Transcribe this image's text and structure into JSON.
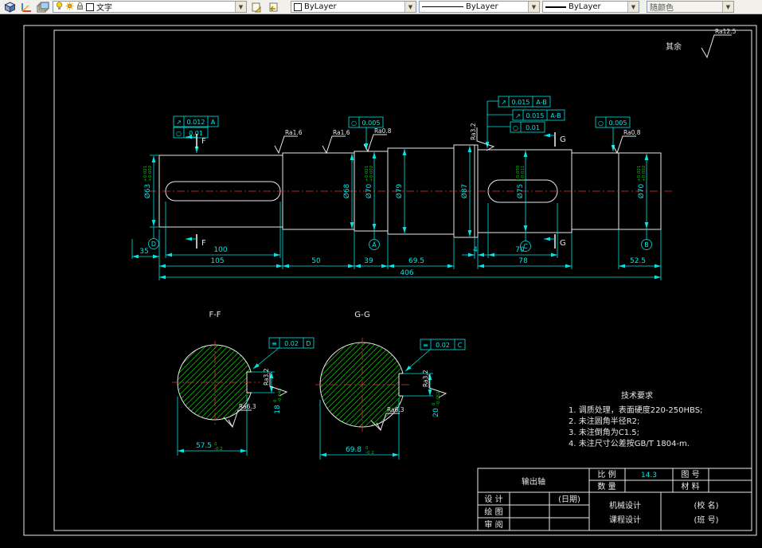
{
  "toolbar": {
    "layer": {
      "value": "文字"
    },
    "color": {
      "value": "ByLayer"
    },
    "linetype": {
      "value": "ByLayer"
    },
    "lineweight": {
      "value": "ByLayer"
    },
    "plotstyle": {
      "value": "随颜色"
    }
  },
  "drawing": {
    "general_note": {
      "prefix": "其余",
      "ra": "Ra12.5"
    },
    "section_titles": {
      "ff": "F-F",
      "gg": "G-G"
    },
    "cut_labels": {
      "f": "F",
      "g": "G"
    },
    "diameters": {
      "d63": {
        "t": "Ø63",
        "u": "+0.021",
        "l": "+0.002"
      },
      "d68": {
        "t": "Ø68"
      },
      "d70a": {
        "t": "Ø70",
        "u": "+0.021",
        "l": "+0.002"
      },
      "d79": {
        "t": "Ø79"
      },
      "d87": {
        "t": "Ø87"
      },
      "d75": {
        "t": "Ø75",
        "u": "+0.030",
        "l": "+0.011"
      },
      "d70b": {
        "t": "Ø70",
        "u": "+0.021",
        "l": "+0.002"
      }
    },
    "lengths": {
      "a": "35",
      "b": "100",
      "c": "70",
      "d": "105",
      "e": "50",
      "f": "39",
      "g": "69.5",
      "h": "4",
      "i": "78",
      "j": "52.5",
      "k": "406"
    },
    "ff": {
      "w": "57.5",
      "wu": "0",
      "wl": "-0.2",
      "k": "18",
      "ku": "0",
      "kl": "-0.043"
    },
    "gg": {
      "w": "69.8",
      "wu": "0",
      "wl": "-0.2",
      "k": "20",
      "ku": "0",
      "kl": "-0.052"
    },
    "ra": {
      "r1": "Ra1.6",
      "r2": "Ra1.6",
      "r3": "Ra0.8",
      "r4": "Ra3.2",
      "r5": "Ra0.8",
      "f1": "Ra3.2",
      "f2": "Ra6.3",
      "g1": "Ra3.2",
      "g2": "Ra6.3"
    },
    "gdt": {
      "f1": {
        "s": "↗",
        "v": "0.012",
        "r": "A"
      },
      "f2": {
        "s": "○",
        "v": "0.01"
      },
      "f3": {
        "s": "○",
        "v": "0.005"
      },
      "f4": {
        "s": "↗",
        "v": "0.015",
        "r": "A-B"
      },
      "f5": {
        "s": "↗",
        "v": "0.015",
        "r": "A-B"
      },
      "f6": {
        "s": "○",
        "v": "0.01"
      },
      "f7": {
        "s": "○",
        "v": "0.005"
      },
      "s1": {
        "s": "≡",
        "v": "0.02",
        "r": "D"
      },
      "s2": {
        "s": "≡",
        "v": "0.02",
        "r": "C"
      }
    },
    "datums": {
      "a": "A",
      "b": "B",
      "c": "C",
      "d": "D"
    },
    "tech": {
      "title": "技术要求",
      "l1": "1. 调质处理，表面硬度220-250HBS;",
      "l2": "2. 未注圆角半径R2;",
      "l3": "3. 未注倒角为C1.5;",
      "l4": "4. 未注尺寸公差按GB/T 1804-m."
    },
    "tb": {
      "name": "输出轴",
      "scale_l": "比 例",
      "scale_v": "14.3",
      "qty_l": "数 量",
      "no_l": "图 号",
      "mat_l": "材 料",
      "design": "设 计",
      "date": "(日期)",
      "draft": "绘 图",
      "check": "审 阅",
      "course1": "机械设计",
      "course2": "课程设计",
      "school": "(校 名)",
      "cls": "(班 号)"
    }
  }
}
